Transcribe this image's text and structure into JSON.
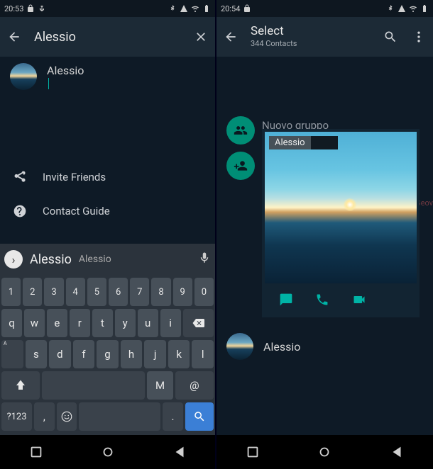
{
  "left": {
    "status_time": "20:53",
    "search_title": "Alessio",
    "contact_name": "Alessio",
    "invite_label": "Invite Friends",
    "guide_label": "Contact Guide",
    "suggestion_primary": "Alessio",
    "suggestion_secondary": "Alessio",
    "number_row": [
      "1",
      "2",
      "3",
      "4",
      "5",
      "6",
      "7",
      "8",
      "9",
      "0"
    ],
    "row1": [
      "q",
      "w",
      "e",
      "r",
      "t",
      "y",
      "u",
      "i"
    ],
    "row2": [
      "s",
      "d",
      "f",
      "g",
      "h",
      "j",
      "k",
      "l"
    ],
    "row3_m": "M",
    "row3_at": "@",
    "sym_key": "?123",
    "comma_key": ",",
    "period_key": "."
  },
  "right": {
    "status_time": "20:54",
    "title": "Select",
    "subtitle": "344 Contacts",
    "nuovo_label": "Nuovo gruppo",
    "popup_name": "Alessio",
    "list_contact": "Alessio",
    "side_label": "Geov"
  }
}
